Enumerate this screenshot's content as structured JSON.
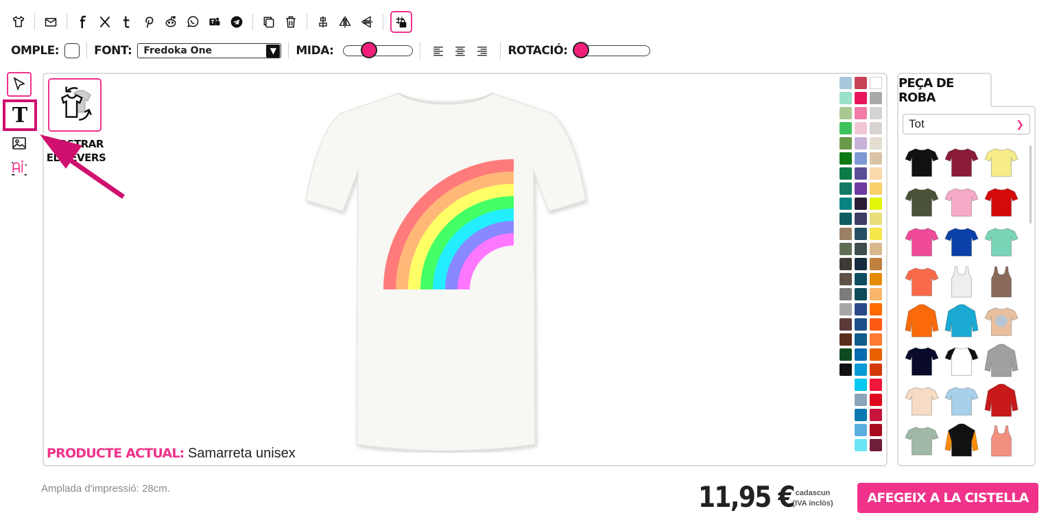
{
  "toolbar": {
    "icons": [
      "tshirt-icon",
      "mail-icon",
      "facebook-icon",
      "x-icon",
      "tumblr-icon",
      "pinterest-icon",
      "reddit-icon",
      "whatsapp-icon",
      "teams-icon",
      "telegram-icon",
      "duplicate-icon",
      "trash-icon",
      "align-center-icon",
      "flip-horizontal-icon",
      "flip-vertical-icon",
      "grid-lock-icon"
    ]
  },
  "options": {
    "fill_label": "OMPLE:",
    "font_label": "FONT:",
    "font_value": "Fredoka One",
    "size_label": "MIDA:",
    "size_level": 0.35,
    "rotation_label": "ROTACIÓ:",
    "rotation_level": 0.0
  },
  "left_tools": {
    "icons": [
      "cursor-icon",
      "text-icon",
      "image-icon",
      "ai-icon"
    ],
    "text_tool_glyph": "T"
  },
  "canvas": {
    "reverse_label_line1": "MOSTRAR",
    "reverse_label_line2": "EL REVERS",
    "current_product_label": "PRODUCTE ACTUAL:",
    "current_product_value": "Samarreta unisex"
  },
  "palette": {
    "colors": [
      "#a8c8dc",
      "#c94356",
      "#ffffff",
      "#9be0c8",
      "#e8135c",
      "#a9a9a9",
      "#a8c890",
      "#f27ba8",
      "#d3d3d3",
      "#3fc25c",
      "#f2c7d4",
      "#d9d4cf",
      "#6a9a4a",
      "#c7b1d9",
      "#e4ded2",
      "#0f7a14",
      "#7d99d4",
      "#d9c5a6",
      "#0d7a4a",
      "#5a4f96",
      "#fbd8a8",
      "#127a62",
      "#6f3aa0",
      "#fad06a",
      "#0b8282",
      "#2a1f36",
      "#e2f50a",
      "#0e5d63",
      "#3d3d66",
      "#e8df7c",
      "#998065",
      "#244e61",
      "#f6e84a",
      "#5d6e55",
      "#3d4d4e",
      "#d9b78b",
      "#3d3b33",
      "#162b3d",
      "#c08040",
      "#5e5346",
      "#0f4d63",
      "#e68a00",
      "#7c7c7c",
      "#0e4a5a",
      "#fbb56a",
      "#a6a6a6",
      "#2a4a8a",
      "#ff6a00",
      "#5c3a3a",
      "#1e4f8c",
      "#ff5a14",
      "#5a2e1e",
      "#0f5d8c",
      "#ff7a33",
      "#0f4a1e",
      "#0a6cb0",
      "#e86000",
      "#111111",
      "#0a9ad6",
      "#d43a0a",
      null,
      "#00c8f0",
      "#f2163a",
      null,
      "#8aa6b8",
      "#e00a1e",
      null,
      "#0a7ab0",
      "#c8143c",
      null,
      "#5aaee0",
      "#a80a20",
      null,
      "#6ae4f5",
      "#6e1e3a"
    ]
  },
  "panel": {
    "tab_label": "PEÇA DE ROBA",
    "filter_value": "Tot",
    "garments": [
      {
        "name": "black-tshirt",
        "color": "#111111"
      },
      {
        "name": "burgundy-tshirt",
        "color": "#8a1c3a"
      },
      {
        "name": "yellow-tshirt",
        "color": "#f6ec8a"
      },
      {
        "name": "olive-tshirt",
        "color": "#4a5238"
      },
      {
        "name": "pink-tshirt",
        "color": "#f6aac8"
      },
      {
        "name": "red-tshirt",
        "color": "#d40a0a"
      },
      {
        "name": "fuchsia-tshirt",
        "color": "#f04a9a"
      },
      {
        "name": "royal-blue-tshirt",
        "color": "#0a40a8"
      },
      {
        "name": "mint-tshirt",
        "color": "#7ad4b8"
      },
      {
        "name": "coral-tshirt",
        "color": "#fa6a4a"
      },
      {
        "name": "white-tank",
        "color": "#eeeeee"
      },
      {
        "name": "brown-tank",
        "color": "#8a6a5a"
      },
      {
        "name": "orange-hoodie",
        "color": "#fa6a0a"
      },
      {
        "name": "cyan-hoodie",
        "color": "#1aaad4"
      },
      {
        "name": "tiedye-tshirt",
        "color": "#e8c0a0"
      },
      {
        "name": "navy-tshirt",
        "color": "#0a0a2a"
      },
      {
        "name": "raglan-tshirt",
        "color": "#ffffff"
      },
      {
        "name": "grey-hoodie",
        "color": "#a0a0a0"
      },
      {
        "name": "peach-tshirt",
        "color": "#f6dcc4"
      },
      {
        "name": "gradient-tshirt",
        "color": "#a8d0ea"
      },
      {
        "name": "varsity-jacket",
        "color": "#c81a1a"
      },
      {
        "name": "sage-longsleeve",
        "color": "#a0b8a8"
      },
      {
        "name": "black-orange-hoodie",
        "color": "#111111"
      },
      {
        "name": "salmon-tank",
        "color": "#f29080"
      }
    ]
  },
  "footer": {
    "print_width": "Amplada d'impressió: 28cm.",
    "price": "11,95 €",
    "price_note_line1": "cadascun",
    "price_note_line2": "(IVA inclòs)",
    "cart_button": "AFEGEIX A LA CISTELLA"
  },
  "colors": {
    "accent": "#f0328a",
    "highlight": "#d0106e"
  }
}
